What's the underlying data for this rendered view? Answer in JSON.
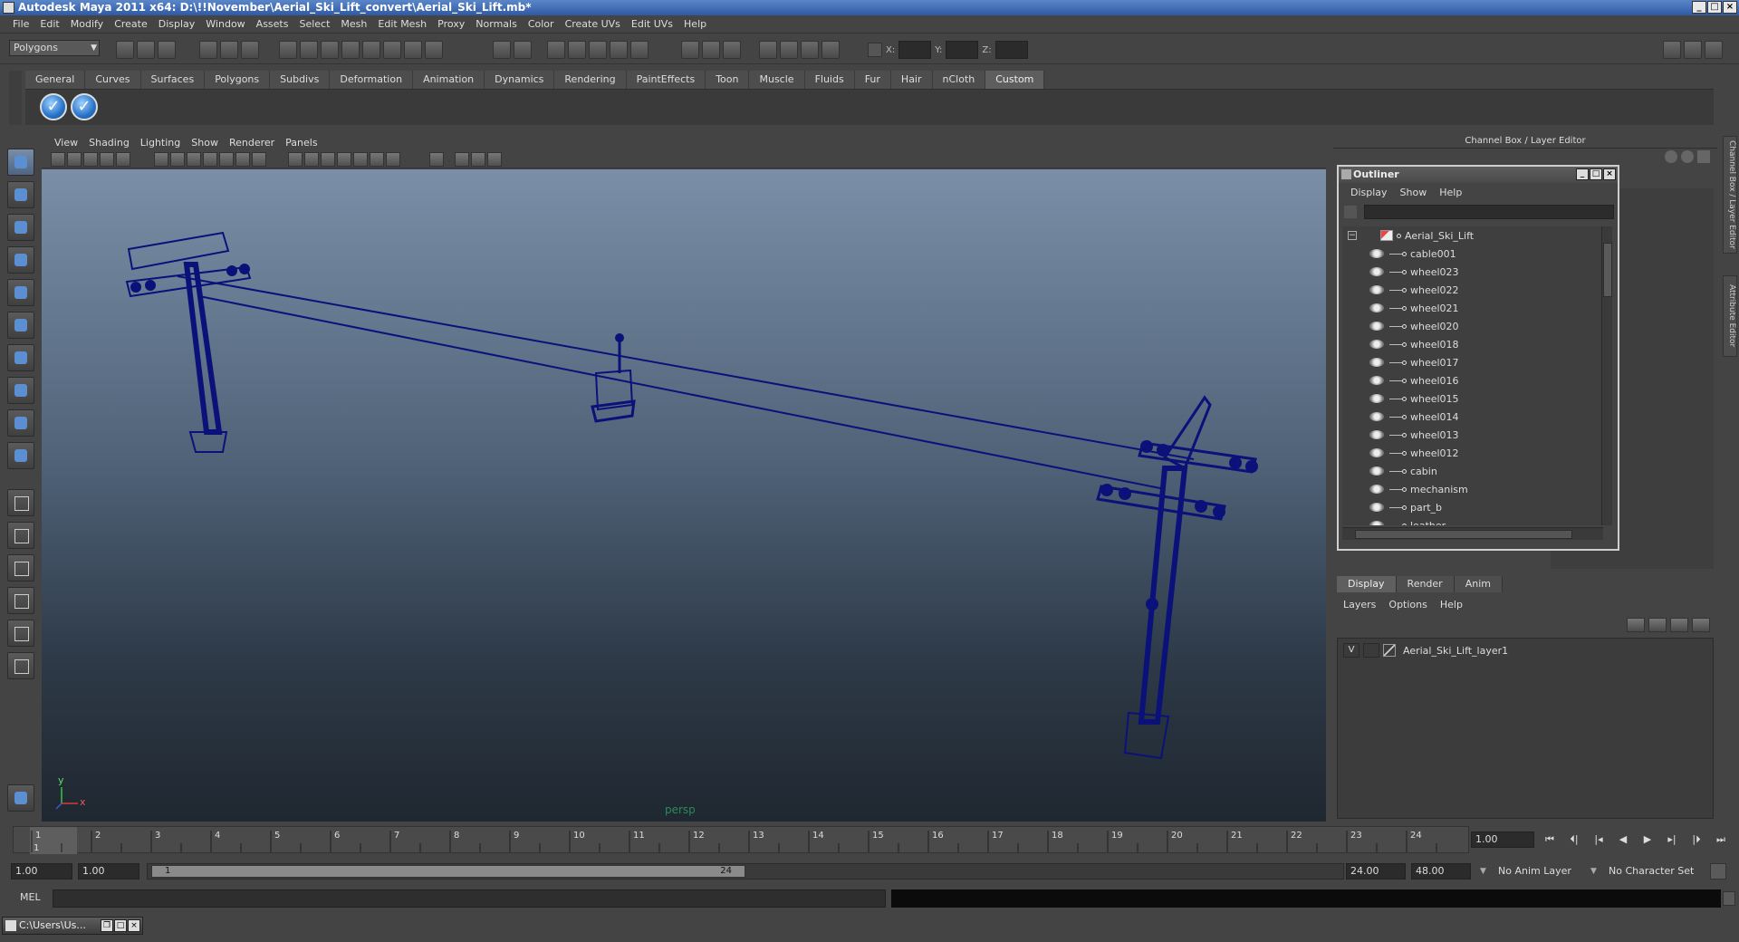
{
  "window": {
    "title": "Autodesk Maya 2011 x64: D:\\!!November\\Aerial_Ski_Lift_convert\\Aerial_Ski_Lift.mb*",
    "minimize": "_",
    "maximize": "□",
    "close": "×"
  },
  "menubar": [
    "File",
    "Edit",
    "Modify",
    "Create",
    "Display",
    "Window",
    "Assets",
    "Select",
    "Mesh",
    "Edit Mesh",
    "Proxy",
    "Normals",
    "Color",
    "Create UVs",
    "Edit UVs",
    "Help"
  ],
  "statusline": {
    "mode": "Polygons",
    "x_label": "X:",
    "y_label": "Y:",
    "z_label": "Z:"
  },
  "shelf": {
    "tabs": [
      "General",
      "Curves",
      "Surfaces",
      "Polygons",
      "Subdivs",
      "Deformation",
      "Animation",
      "Dynamics",
      "Rendering",
      "PaintEffects",
      "Toon",
      "Muscle",
      "Fluids",
      "Fur",
      "Hair",
      "nCloth",
      "Custom"
    ],
    "active_tab": "Custom"
  },
  "viewport": {
    "menu": [
      "View",
      "Shading",
      "Lighting",
      "Show",
      "Renderer",
      "Panels"
    ],
    "camera_label": "persp",
    "axis_y": "y",
    "axis_x": "x"
  },
  "right_panel": {
    "title": "Channel Box / Layer Editor",
    "vertical_tab_1": "Channel Box / Layer Editor",
    "vertical_tab_2": "Attribute Editor"
  },
  "outliner": {
    "title": "Outliner",
    "menu": [
      "Display",
      "Show",
      "Help"
    ],
    "root": "Aerial_Ski_Lift",
    "items": [
      "cable001",
      "wheel023",
      "wheel022",
      "wheel021",
      "wheel020",
      "wheel018",
      "wheel017",
      "wheel016",
      "wheel015",
      "wheel014",
      "wheel013",
      "wheel012",
      "cabin",
      "mechanism",
      "part_b",
      "leather"
    ]
  },
  "layer_editor": {
    "tabs": [
      "Display",
      "Render",
      "Anim"
    ],
    "active_tab": "Display",
    "menu": [
      "Layers",
      "Options",
      "Help"
    ],
    "layers": [
      {
        "visible": "V",
        "name": "Aerial_Ski_Lift_layer1"
      }
    ]
  },
  "timeline": {
    "ticks": [
      "1",
      "2",
      "3",
      "4",
      "5",
      "6",
      "7",
      "8",
      "9",
      "10",
      "11",
      "12",
      "13",
      "14",
      "15",
      "16",
      "17",
      "18",
      "19",
      "20",
      "21",
      "22",
      "23",
      "24"
    ],
    "current_frame_marker": "1",
    "current_time": "1.00"
  },
  "range": {
    "start_time": "1.00",
    "playback_start": "1.00",
    "range_start_label": "1",
    "range_end_label": "24",
    "playback_end": "24.00",
    "end_time": "48.00",
    "anim_layer": "No Anim Layer",
    "character_set": "No Character Set"
  },
  "command_line": {
    "label": "MEL"
  },
  "minimized_window": {
    "title": "C:\\Users\\Us..."
  }
}
